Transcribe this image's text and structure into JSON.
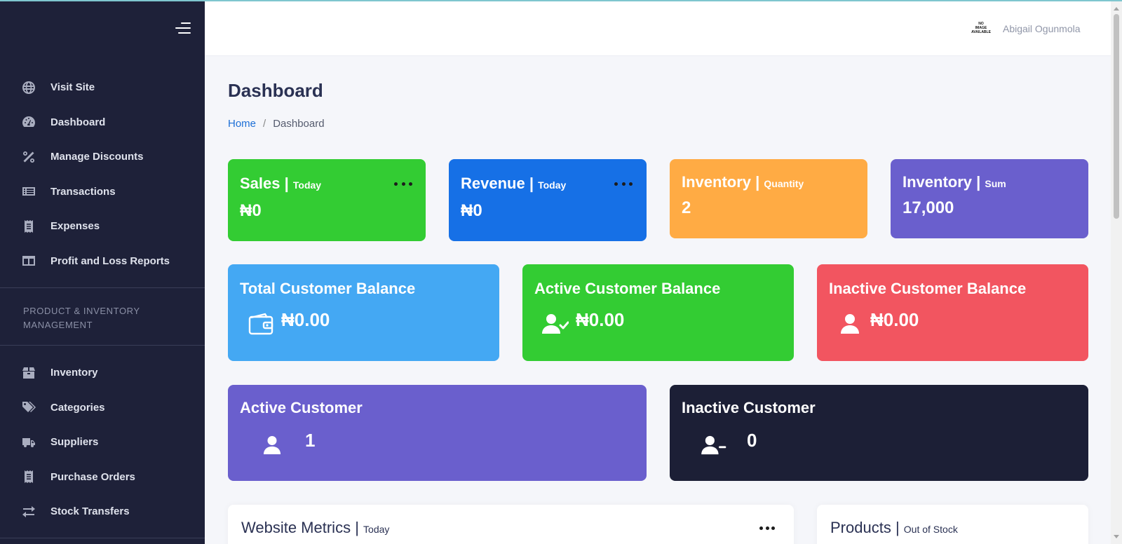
{
  "sidebar": {
    "items_top": [
      {
        "label": "Visit Site",
        "icon": "globe-icon"
      },
      {
        "label": "Dashboard",
        "icon": "gauge-icon"
      },
      {
        "label": "Manage Discounts",
        "icon": "percent-icon"
      },
      {
        "label": "Transactions",
        "icon": "list-icon"
      },
      {
        "label": "Expenses",
        "icon": "receipt-icon"
      },
      {
        "label": "Profit and Loss Reports",
        "icon": "columns-icon"
      }
    ],
    "section_heading": "PRODUCT & INVENTORY MANAGEMENT",
    "items_bottom": [
      {
        "label": "Inventory",
        "icon": "box-icon"
      },
      {
        "label": "Categories",
        "icon": "tags-icon"
      },
      {
        "label": "Suppliers",
        "icon": "truck-icon"
      },
      {
        "label": "Purchase Orders",
        "icon": "receipt-icon"
      },
      {
        "label": "Stock Transfers",
        "icon": "transfer-icon"
      }
    ]
  },
  "header": {
    "avatar_text": [
      "NO",
      "IMAGE",
      "AVAILABLE"
    ],
    "user_name": "Abigail Ogunmola"
  },
  "page": {
    "title": "Dashboard",
    "breadcrumb": {
      "home": "Home",
      "separator": "/",
      "current": "Dashboard"
    }
  },
  "stats": {
    "sales": {
      "title": "Sales",
      "sub": "Today",
      "value": "₦0",
      "color": "#33cc33"
    },
    "revenue": {
      "title": "Revenue",
      "sub": "Today",
      "value": "₦0",
      "color": "#1670e6"
    },
    "inventory_qty": {
      "title": "Inventory",
      "sub": "Quantity",
      "value": "2",
      "color": "#ffab44"
    },
    "inventory_sum": {
      "title": "Inventory",
      "sub": "Sum",
      "value": "17,000",
      "color": "#6a5fcd"
    }
  },
  "balances": {
    "total": {
      "title": "Total Customer Balance",
      "value": "₦0.00",
      "color": "#44a8f3"
    },
    "active": {
      "title": "Active Customer Balance",
      "value": "₦0.00",
      "color": "#33cc33"
    },
    "inactive": {
      "title": "Inactive Customer Balance",
      "value": "₦0.00",
      "color": "#f25560"
    }
  },
  "customers": {
    "active": {
      "title": "Active Customer",
      "value": "1",
      "color": "#6a5fcd"
    },
    "inactive": {
      "title": "Inactive Customer",
      "value": "0",
      "color": "#1c1f36"
    }
  },
  "panels": {
    "metrics": {
      "title": "Website Metrics",
      "sub": "Today"
    },
    "products": {
      "title": "Products",
      "sub": "Out of Stock"
    }
  }
}
